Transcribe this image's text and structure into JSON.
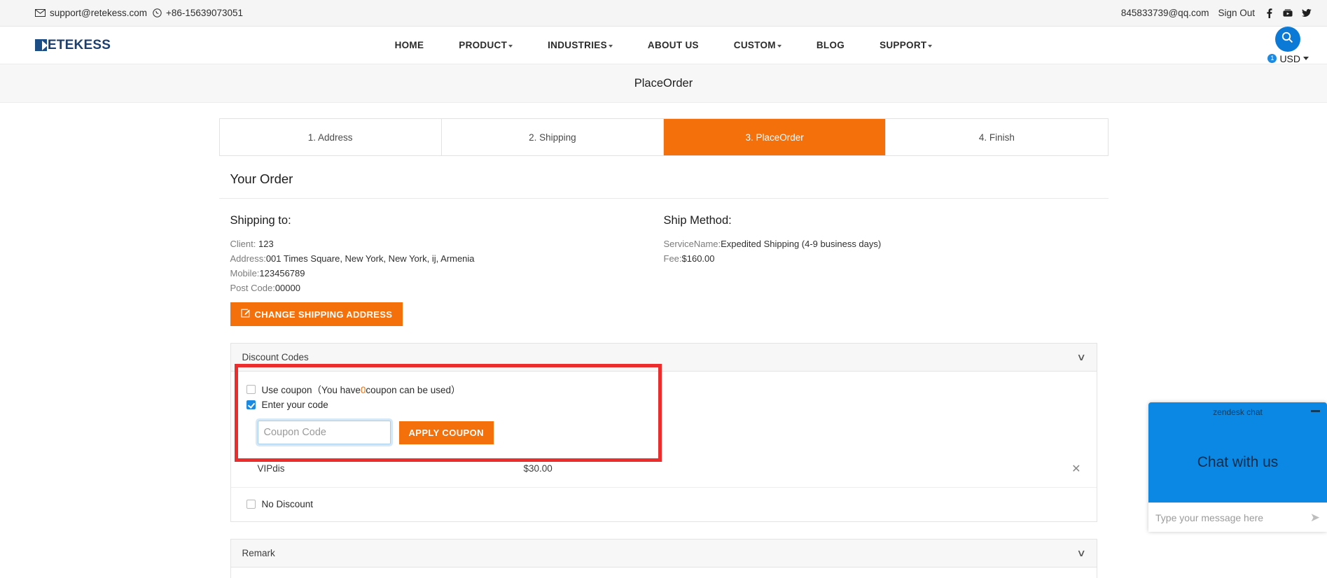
{
  "topbar": {
    "email": "support@retekess.com",
    "phone": "+86-15639073051",
    "account_email": "845833739@qq.com",
    "sign_out": "Sign Out",
    "social": [
      "facebook-icon",
      "youtube-icon",
      "twitter-icon"
    ]
  },
  "nav": {
    "logo": "ETEKESS",
    "items": [
      {
        "label": "HOME",
        "caret": false
      },
      {
        "label": "PRODUCT",
        "caret": true
      },
      {
        "label": "INDUSTRIES",
        "caret": true
      },
      {
        "label": "ABOUT US",
        "caret": false
      },
      {
        "label": "CUSTOM",
        "caret": true
      },
      {
        "label": "BLOG",
        "caret": false
      },
      {
        "label": "SUPPORT",
        "caret": true
      }
    ],
    "cart_count": "1",
    "currency": "USD"
  },
  "banner": {
    "title": "PlaceOrder"
  },
  "steps": [
    {
      "label": "1. Address",
      "active": false
    },
    {
      "label": "2. Shipping",
      "active": false
    },
    {
      "label": "3. PlaceOrder",
      "active": true
    },
    {
      "label": "4. Finish",
      "active": false
    }
  ],
  "order": {
    "heading": "Your Order",
    "shipping_to": {
      "title": "Shipping to:",
      "client_label": "Client:",
      "client_value": "123",
      "address_label": "Address:",
      "address_value": "001 Times Square, New York, New York, ij, Armenia",
      "mobile_label": "Mobile:",
      "mobile_value": "123456789",
      "postcode_label": "Post Code:",
      "postcode_value": "00000",
      "change_button": "CHANGE SHIPPING ADDRESS",
      "change_button_icon": "edit-pencil-icon"
    },
    "ship_method": {
      "title": "Ship Method:",
      "service_label": "ServiceName:",
      "service_value": "Expedited Shipping (4-9 business days)",
      "fee_label": "Fee:",
      "fee_value": "$160.00"
    }
  },
  "discount": {
    "section_title": "Discount Codes",
    "chevron": "∨",
    "use_coupon_prefix": "Use coupon（You have",
    "use_coupon_count": "0",
    "use_coupon_suffix": "coupon can be used）",
    "use_coupon_checked": false,
    "enter_code_label": "Enter your code",
    "enter_code_checked": true,
    "coupon_placeholder": "Coupon Code",
    "coupon_value": "",
    "apply_label": "APPLY COUPON",
    "items": [
      {
        "name": "VIPdis",
        "amount": "$30.00",
        "remove_icon": "close-x-icon"
      }
    ],
    "no_discount_label": "No Discount",
    "no_discount_checked": false
  },
  "remark": {
    "section_title": "Remark",
    "chevron": "∨"
  },
  "chat": {
    "header": "zendesk chat",
    "body": "Chat with us",
    "placeholder": "Type your message here",
    "value": "",
    "send_icon": "send-arrow-icon",
    "minimize_icon": "minimize-icon"
  },
  "colors": {
    "accent_orange": "#f4700a",
    "accent_blue": "#0b88e3",
    "highlight_red": "#ec2d2d",
    "logo_blue": "#1c4e86"
  }
}
